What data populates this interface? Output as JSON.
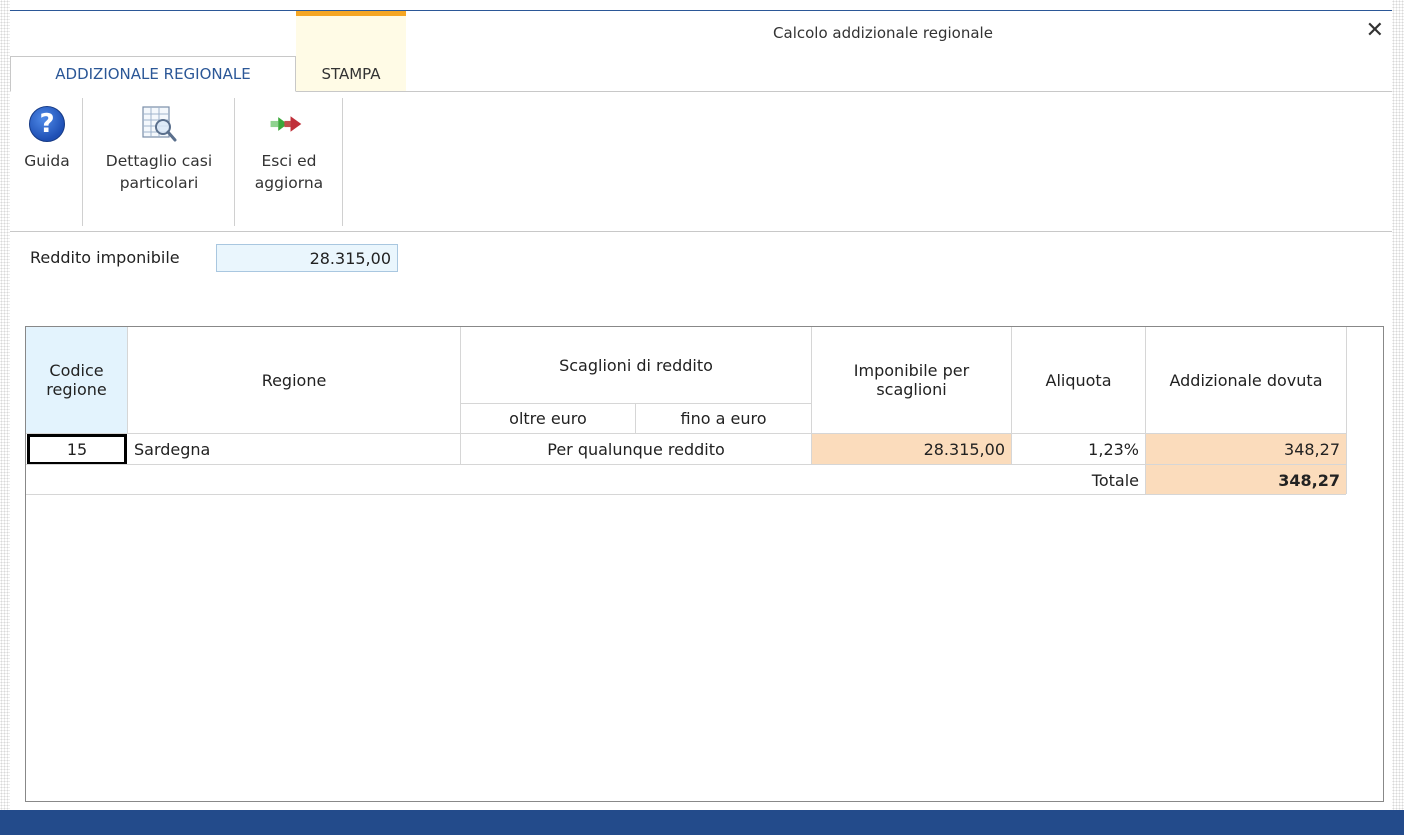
{
  "window": {
    "title": "Calcolo addizionale regionale",
    "close": "✕"
  },
  "tabs": [
    {
      "label": "ADDIZIONALE REGIONALE"
    },
    {
      "label": "STAMPA"
    }
  ],
  "ribbon": {
    "guida": "Guida",
    "dettaglio_1": "Dettaglio casi",
    "dettaglio_2": "particolari",
    "esci_1": "Esci ed",
    "esci_2": "aggiorna"
  },
  "reddito": {
    "label": "Reddito imponibile",
    "value": "28.315,00"
  },
  "grid": {
    "headers": {
      "codice_1": "Codice",
      "codice_2": "regione",
      "regione": "Regione",
      "scaglioni": "Scaglioni di reddito",
      "oltre": "oltre euro",
      "fino": "fino a euro",
      "imponibile_1": "Imponibile per",
      "imponibile_2": "scaglioni",
      "aliquota": "Aliquota",
      "addizionale": "Addizionale dovuta"
    },
    "row": {
      "codice": "15",
      "regione": "Sardegna",
      "scaglione": "Per qualunque reddito",
      "imponibile": "28.315,00",
      "aliquota": "1,23%",
      "addizionale": "348,27"
    },
    "totale": {
      "label": "Totale",
      "value": "348,27"
    }
  }
}
